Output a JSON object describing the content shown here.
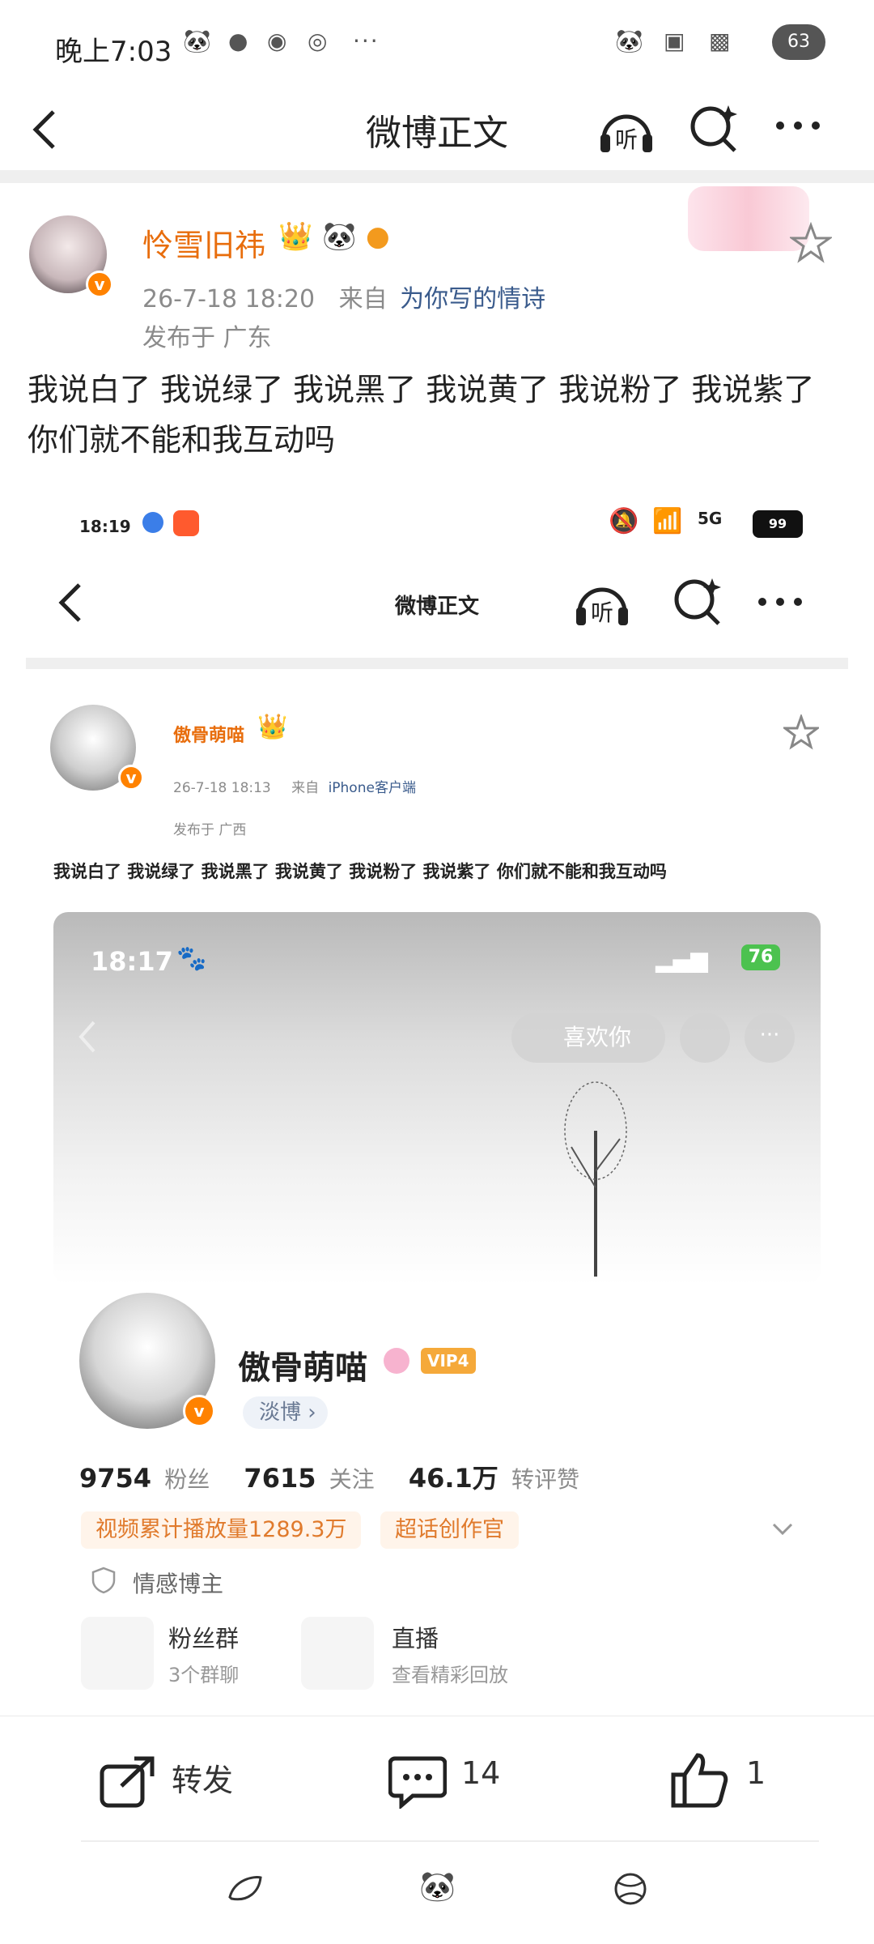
{
  "status_bar": {
    "time": "晚上7:03",
    "battery": "63",
    "more": "···"
  },
  "nav": {
    "title": "微博正文"
  },
  "post": {
    "author": "怜雪旧祎",
    "date": "26-7-18 18:20",
    "from_label": "来自",
    "source": "为你写的情诗",
    "location": "发布于 广东",
    "text": "我说白了 我说绿了 我说黑了 我说黄了 我说粉了 我说紫了 你们就不能和我互动吗"
  },
  "inner_screenshot": {
    "status_time": "18:19",
    "status_battery": "99",
    "status_net": "5G",
    "nav_title": "微博正文",
    "author": "傲骨萌喵",
    "date": "26-7-18 18:13",
    "from_label": "来自",
    "source": "iPhone客户端",
    "location": "发布于 广西",
    "text": "我说白了 我说绿了 我说黑了 我说黄了 我说粉了 我说紫了 你们就不能和我互动吗",
    "profile": {
      "status_time": "18:17",
      "status_battery": "76",
      "like_button": "喜欢你",
      "name": "傲骨萌喵",
      "vip": "VIP4",
      "tan_bo": "淡博 ›",
      "followers_num": "9754",
      "followers_lbl": "粉丝",
      "following_num": "7615",
      "following_lbl": "关注",
      "likes_num": "46.1万",
      "likes_lbl": "转评赞",
      "tag1": "视频累计播放量1289.3万",
      "tag2": "超话创作官",
      "role": "情感博主",
      "fan_group_title": "粉丝群",
      "fan_group_sub": "3个群聊",
      "live_title": "直播",
      "live_sub": "查看精彩回放"
    }
  },
  "actions": {
    "repost": "转发",
    "comments": "14",
    "likes": "1"
  },
  "colors": {
    "accent_orange": "#ff8200",
    "username_orange": "#e86d0c",
    "link_blue": "#3a5b8c"
  }
}
